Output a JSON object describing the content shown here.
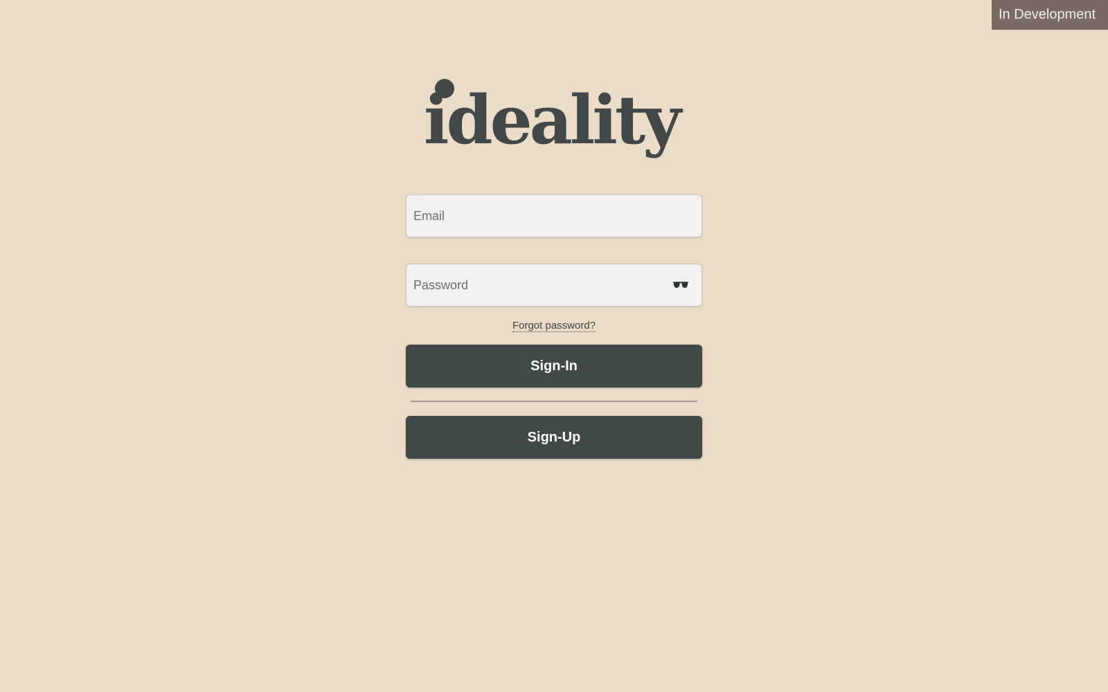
{
  "badge": {
    "label": "In Development"
  },
  "logo": {
    "text": "ideality"
  },
  "form": {
    "email_placeholder": "Email",
    "password_placeholder": "Password",
    "password_toggle_icon": "sunglasses-icon",
    "forgot_password_label": "Forgot password?",
    "signin_label": "Sign-In",
    "signup_label": "Sign-Up"
  },
  "colors": {
    "background": "#eadcc7",
    "primary": "#414948",
    "badge": "#786b63",
    "input_background": "#f2f2f1"
  }
}
